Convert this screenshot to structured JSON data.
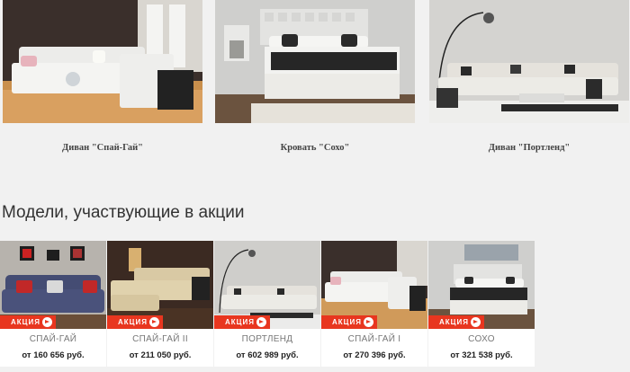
{
  "featured": [
    {
      "caption": "Диван \"Спай-Гай\"",
      "icon": "sofa-photo"
    },
    {
      "caption": "Кровать \"Сохо\"",
      "icon": "bed-photo"
    },
    {
      "caption": "Диван \"Портленд\"",
      "icon": "sofa-photo"
    }
  ],
  "promo": {
    "title": "Модели, участвующие в акции",
    "badge_label": "АКЦИЯ",
    "accent_color": "#e8361f",
    "cards": [
      {
        "name": "СПАЙ-ГАЙ",
        "price": "от 160 656 руб."
      },
      {
        "name": "СПАЙ-ГАЙ II",
        "price": "от 211 050 руб."
      },
      {
        "name": "ПОРТЛЕНД",
        "price": "от 602 989 руб."
      },
      {
        "name": "СПАЙ-ГАЙ I",
        "price": "от 270 396 руб."
      },
      {
        "name": "СОХО",
        "price": "от 321 538 руб."
      }
    ]
  }
}
